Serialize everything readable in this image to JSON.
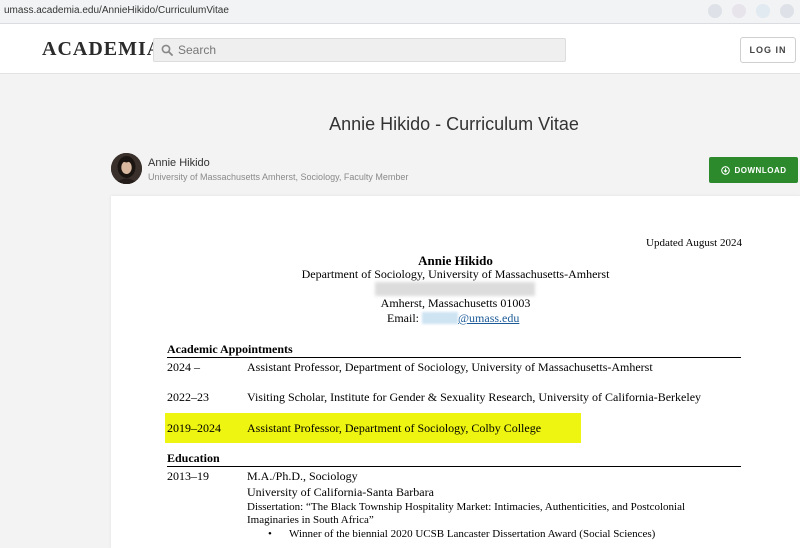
{
  "browser": {
    "url": "umass.academia.edu/AnnieHikido/CurriculumVitae"
  },
  "nav": {
    "logo": "ACADEMIA",
    "search_placeholder": "Search",
    "login_label": "LOG IN"
  },
  "document": {
    "title": "Annie Hikido - Curriculum Vitae",
    "download_label": "DOWNLOAD"
  },
  "author": {
    "name": "Annie Hikido",
    "affiliation": "University of Massachusetts Amherst, Sociology, Faculty Member"
  },
  "cv": {
    "updated": "Updated August 2024",
    "name": "Annie Hikido",
    "department": "Department of Sociology, University of Massachusetts-Amherst",
    "city": "Amherst, Massachusetts 01003",
    "email_label": "Email:",
    "email_domain": "@umass.edu",
    "appointments_heading": "Academic Appointments",
    "appointments": [
      {
        "years": "2024 –",
        "text": "Assistant Professor, Department of Sociology, University of Massachusetts-Amherst"
      },
      {
        "years": "2022–23",
        "text": "Visiting Scholar, Institute for Gender & Sexuality Research, University of California-Berkeley"
      },
      {
        "years": "2019–2024",
        "text": "Assistant Professor, Department of Sociology, Colby College"
      }
    ],
    "education_heading": "Education",
    "education": {
      "years": "2013–19",
      "degree": "M.A./Ph.D., Sociology",
      "school": "University of California-Santa Barbara",
      "dissertation_line1": "Dissertation: “The Black Township Hospitality Market: Intimacies, Authenticities, and Postcolonial",
      "dissertation_line2": "Imaginaries in South Africa”",
      "bullet": "•",
      "award": "Winner of the biennial 2020 UCSB Lancaster Dissertation Award (Social Sciences)"
    }
  },
  "colors": {
    "download_green": "#2c8a2c",
    "highlight_yellow": "#eef511",
    "link_blue": "#1a5a96"
  }
}
